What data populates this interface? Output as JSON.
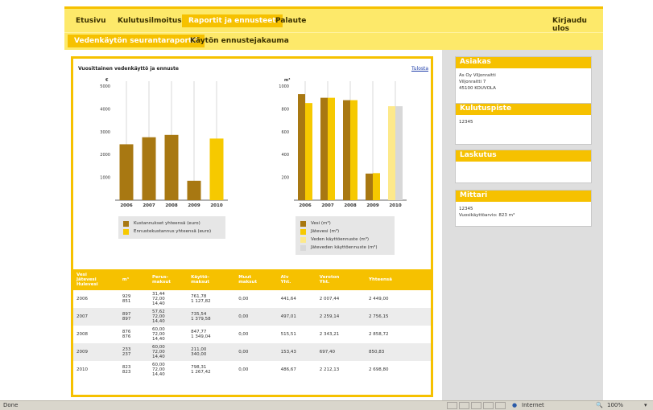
{
  "topnav": {
    "items": [
      {
        "label": "Etusivu"
      },
      {
        "label": "Kulutusilmoitus"
      },
      {
        "label": "Raportit ja ennusteet",
        "active": true
      },
      {
        "label": "Palaute"
      }
    ],
    "logout_label": "Kirjaudu ulos"
  },
  "subnav": {
    "items": [
      {
        "label": "Vedenkäytön seurantaraportti",
        "active": true
      },
      {
        "label": "Käytön ennustejakauma"
      }
    ]
  },
  "report": {
    "title": "Vuosittainen vedenkäyttö ja ennuste",
    "print_label": "Tulosta"
  },
  "chart_data": [
    {
      "type": "bar",
      "ylabel": "€",
      "ylim": [
        0,
        5000
      ],
      "yticks": [
        1000,
        2000,
        3000,
        4000,
        5000
      ],
      "categories": [
        "2006",
        "2007",
        "2008",
        "2009",
        "2010"
      ],
      "series": [
        {
          "name": "Kustannukset yhteensä (euro)",
          "color": "#a87812",
          "values": [
            2449.0,
            2756.15,
            2858.72,
            850.83,
            null
          ]
        },
        {
          "name": "Ennustekustannus yhteensä (euro)",
          "color": "#f6c900",
          "values": [
            null,
            null,
            null,
            null,
            2698.8
          ]
        }
      ],
      "grid": "vertical",
      "legend": "below"
    },
    {
      "type": "bar",
      "ylabel": "m³",
      "ylim": [
        0,
        1000
      ],
      "yticks": [
        200,
        400,
        600,
        800,
        1000
      ],
      "categories": [
        "2006",
        "2007",
        "2008",
        "2009",
        "2010"
      ],
      "series": [
        {
          "name": "Vesi (m³)",
          "color": "#a87812",
          "values": [
            929,
            897,
            876,
            233,
            null
          ]
        },
        {
          "name": "Jätevesi (m³)",
          "color": "#f6c900",
          "values": [
            851,
            897,
            876,
            237,
            null
          ]
        },
        {
          "name": "Veden käyttöennuste (m³)",
          "color": "#fde98a",
          "values": [
            null,
            null,
            null,
            null,
            823
          ]
        },
        {
          "name": "Jäteveden käyttöennuste (m³)",
          "color": "#d8d8d8",
          "values": [
            null,
            null,
            null,
            null,
            823
          ]
        }
      ],
      "grid": "vertical",
      "legend": "below"
    }
  ],
  "table": {
    "headers": [
      "Vesi\nJätevesi\nHulevesi",
      "m³",
      "Perus-\nmaksut",
      "Käyttö-\nmaksut",
      "Muut\nmaksut",
      "Alv\nYht.",
      "Veroton\nYht.",
      "Yhteensä"
    ],
    "rows": [
      [
        "2006",
        "929\n851",
        "31,44\n72,00\n14,40",
        "761,78\n1 127,82",
        "0,00",
        "441,64",
        "2 007,44",
        "2 449,00"
      ],
      [
        "2007",
        "897\n897",
        "57,62\n72,00\n14,40",
        "735,54\n1 379,58",
        "0,00",
        "497,01",
        "2 259,14",
        "2 756,15"
      ],
      [
        "2008",
        "876\n876",
        "60,00\n72,00\n14,40",
        "847,77\n1 349,04",
        "0,00",
        "515,51",
        "2 343,21",
        "2 858,72"
      ],
      [
        "2009",
        "233\n237",
        "60,00\n72,00\n14,40",
        "211,00\n340,00",
        "0,00",
        "153,43",
        "697,40",
        "850,83"
      ],
      [
        "2010",
        "823\n823",
        "60,00\n72,00\n14,40",
        "798,31\n1 267,42",
        "0,00",
        "486,67",
        "2 212,13",
        "2 698,80"
      ]
    ]
  },
  "sidebar": {
    "customer": {
      "title": "Asiakas",
      "lines": [
        "As Oy Viljonraitti",
        "Viljonraitti 7",
        "45100 KOUVOLA"
      ]
    },
    "consumption_point": {
      "title": "Kulutuspiste",
      "lines": [
        "12345"
      ]
    },
    "billing": {
      "title": "Laskutus",
      "lines": []
    },
    "meter": {
      "title": "Mittari",
      "lines": [
        "12345",
        "Vuosikäyttöarvio: 823 m³"
      ]
    }
  },
  "statusbar": {
    "status": "Done",
    "zone": "Internet",
    "zoom": "100%"
  }
}
